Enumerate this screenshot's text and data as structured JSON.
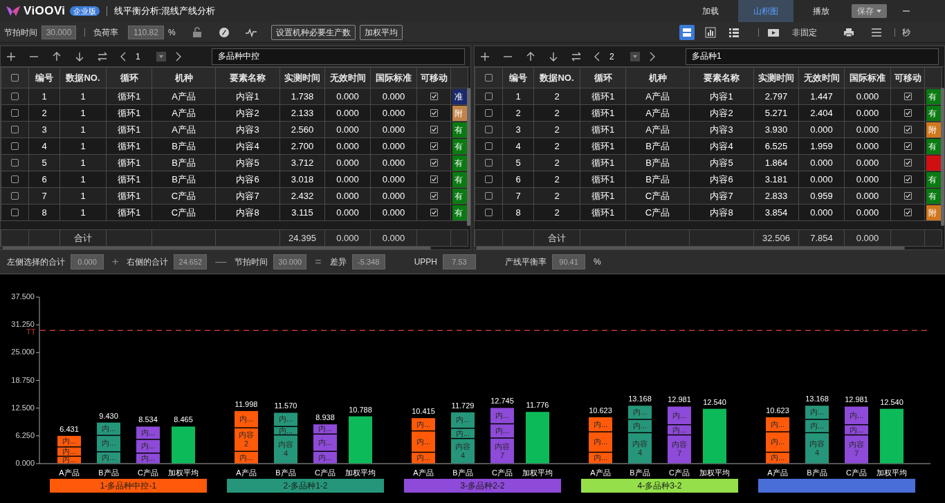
{
  "app": {
    "logo_text": "ViOOVi",
    "edition": "企业版",
    "title": "线平衡分析:混线产线分析"
  },
  "top_tabs": [
    {
      "label": "加载",
      "selected": false
    },
    {
      "label": "山积图",
      "selected": true
    },
    {
      "label": "播放",
      "selected": false
    }
  ],
  "save_button": "保存",
  "toolbar": {
    "takt_label": "节拍时间",
    "takt_value": "30.000",
    "load_label": "负荷率",
    "load_value": "110.82",
    "load_unit": "%",
    "buttons": [
      "设置机种必要生产数",
      "加权平均"
    ],
    "views": [
      {
        "selected": true
      },
      {
        "selected": false
      },
      {
        "selected": false
      }
    ],
    "mode": "非固定",
    "unit": "秒"
  },
  "panels": [
    {
      "page": "1",
      "name": "多品种中控",
      "header_checked": false,
      "columns": [
        "编号",
        "数据NO.",
        "循环",
        "机种",
        "要素名称",
        "实测时间",
        "无效时间",
        "国际标准",
        "可移动"
      ],
      "rows": [
        {
          "checked": false,
          "cells": [
            "1",
            "1",
            "循环1",
            "A产品",
            "内容1",
            "1.738",
            "0.000",
            "0.000"
          ],
          "movable": true,
          "tag": {
            "text": "准",
            "color": "#1b2a6b"
          }
        },
        {
          "checked": false,
          "cells": [
            "2",
            "1",
            "循环1",
            "A产品",
            "内容2",
            "2.133",
            "0.000",
            "0.000"
          ],
          "movable": true,
          "tag": {
            "text": "附",
            "color": "#c0844a"
          }
        },
        {
          "checked": false,
          "cells": [
            "3",
            "1",
            "循环1",
            "A产品",
            "内容3",
            "2.560",
            "0.000",
            "0.000"
          ],
          "movable": true,
          "tag": {
            "text": "有",
            "color": "#0b7a12"
          }
        },
        {
          "checked": false,
          "cells": [
            "4",
            "1",
            "循环1",
            "B产品",
            "内容4",
            "2.700",
            "0.000",
            "0.000"
          ],
          "movable": true,
          "tag": {
            "text": "有",
            "color": "#0b7a12"
          }
        },
        {
          "checked": false,
          "cells": [
            "5",
            "1",
            "循环1",
            "B产品",
            "内容5",
            "3.712",
            "0.000",
            "0.000"
          ],
          "movable": true,
          "tag": {
            "text": "有",
            "color": "#0b7a12"
          }
        },
        {
          "checked": false,
          "cells": [
            "6",
            "1",
            "循环1",
            "B产品",
            "内容6",
            "3.018",
            "0.000",
            "0.000"
          ],
          "movable": true,
          "tag": {
            "text": "有",
            "color": "#0b7a12"
          }
        },
        {
          "checked": false,
          "cells": [
            "7",
            "1",
            "循环1",
            "C产品",
            "内容7",
            "2.432",
            "0.000",
            "0.000"
          ],
          "movable": true,
          "tag": {
            "text": "有",
            "color": "#0b7a12"
          }
        },
        {
          "checked": false,
          "cells": [
            "8",
            "1",
            "循环1",
            "C产品",
            "内容8",
            "3.115",
            "0.000",
            "0.000"
          ],
          "movable": true,
          "tag": {
            "text": "有",
            "color": "#0b7a12"
          }
        }
      ],
      "footer": {
        "label": "合计",
        "values": [
          "24.395",
          "0.000",
          "0.000"
        ]
      }
    },
    {
      "page": "2",
      "name": "多品种1",
      "header_checked": false,
      "columns": [
        "编号",
        "数据NO.",
        "循环",
        "机种",
        "要素名称",
        "实测时间",
        "无效时间",
        "国际标准",
        "可移动"
      ],
      "rows": [
        {
          "checked": false,
          "cells": [
            "1",
            "2",
            "循环1",
            "A产品",
            "内容1",
            "2.797",
            "1.447",
            "0.000"
          ],
          "movable": true,
          "tag": {
            "text": "有",
            "color": "#0b7a12"
          }
        },
        {
          "checked": false,
          "cells": [
            "2",
            "2",
            "循环1",
            "A产品",
            "内容2",
            "5.271",
            "2.404",
            "0.000"
          ],
          "movable": true,
          "tag": {
            "text": "有",
            "color": "#0b7a12"
          }
        },
        {
          "checked": false,
          "cells": [
            "3",
            "2",
            "循环1",
            "A产品",
            "内容3",
            "3.930",
            "0.000",
            "0.000"
          ],
          "movable": true,
          "tag": {
            "text": "附",
            "color": "#d0781e"
          }
        },
        {
          "checked": false,
          "cells": [
            "4",
            "2",
            "循环1",
            "B产品",
            "内容4",
            "6.525",
            "1.959",
            "0.000"
          ],
          "movable": true,
          "tag": {
            "text": "有",
            "color": "#0b7a12"
          }
        },
        {
          "checked": false,
          "cells": [
            "5",
            "2",
            "循环1",
            "B产品",
            "内容5",
            "1.864",
            "0.000",
            "0.000"
          ],
          "movable": true,
          "tag": {
            "color": "#d01010"
          }
        },
        {
          "checked": false,
          "cells": [
            "6",
            "2",
            "循环1",
            "B产品",
            "内容6",
            "3.181",
            "0.000",
            "0.000"
          ],
          "movable": true,
          "tag": {
            "text": "有",
            "color": "#0b7a12"
          }
        },
        {
          "checked": false,
          "cells": [
            "7",
            "2",
            "循环1",
            "C产品",
            "内容7",
            "2.833",
            "0.959",
            "0.000"
          ],
          "movable": true,
          "tag": {
            "text": "有",
            "color": "#0b7a12"
          }
        },
        {
          "checked": false,
          "cells": [
            "8",
            "2",
            "循环1",
            "C产品",
            "内容8",
            "3.854",
            "0.000",
            "0.000"
          ],
          "movable": true,
          "tag": {
            "text": "附",
            "color": "#d0781e"
          }
        }
      ],
      "footer": {
        "label": "合计",
        "values": [
          "32.506",
          "7.854",
          "0.000"
        ]
      }
    }
  ],
  "summary": [
    {
      "label": "左侧选择的合计",
      "value": "0.000",
      "operator": "+"
    },
    {
      "label": "右侧的合计",
      "value": "24.652",
      "operator": "—"
    },
    {
      "label": "节拍时间",
      "value": "30.000",
      "operator": "="
    },
    {
      "label": "差异",
      "value": "-5.348"
    },
    {
      "label": "UPPH",
      "value": "7.53"
    },
    {
      "label": "产线平衡率",
      "value": "90.41",
      "unit": "%"
    }
  ],
  "chart": {
    "chart_data": {
      "type": "bar",
      "stacked": true,
      "ylim": [
        0,
        37.5
      ],
      "yticks": [
        {
          "value": 0,
          "label": "0.000"
        },
        {
          "value": 6.25,
          "label": "6.250"
        },
        {
          "value": 12.5,
          "label": "12.500"
        },
        {
          "value": 18.75,
          "label": "18.750"
        },
        {
          "value": 25,
          "label": "25.000"
        },
        {
          "value": 31.25,
          "label": "31.250"
        },
        {
          "value": 37.5,
          "label": "37.500"
        }
      ],
      "categories": [
        "A产品",
        "B产品",
        "C产品",
        "加权平均",
        "A产品",
        "B产品",
        "C产品",
        "加权平均",
        "A产品",
        "B产品",
        "C产品",
        "加权平均",
        "A产品",
        "B产品",
        "C产品",
        "加权平均",
        "A产品",
        "B产品",
        "C产品",
        "加权平均"
      ],
      "series": [
        {
          "colors": [
            "#ff5a0a",
            "#26967a",
            "#8e4ad8",
            "#0dba5a",
            "#ff5a0a",
            "#26967a",
            "#8e4ad8",
            "#0dba5a",
            "#ff5a0a",
            "#26967a",
            "#8e4ad8",
            "#0dba5a",
            "#ff5a0a",
            "#26967a",
            "#8e4ad8",
            "#0dba5a",
            "#ff5a0a",
            "#26967a",
            "#8e4ad8",
            "#0dba5a"
          ],
          "values": [
            1.7,
            2.7,
            2.4,
            8.5,
            2.8,
            6.5,
            2.8,
            10.8,
            2.6,
            5.7,
            5.8,
            11.8,
            2.6,
            7.0,
            6.5,
            12.5,
            2.6,
            7.0,
            6.5,
            12.5
          ]
        },
        {
          "colors": [
            "#ff5a0a",
            "#26967a",
            "#8e4ad8",
            null,
            "#ff5a0a",
            "#26967a",
            "#8e4ad8",
            null,
            "#ff5a0a",
            "#26967a",
            "#8e4ad8",
            null,
            "#ff5a0a",
            "#26967a",
            "#8e4ad8",
            null,
            "#ff5a0a",
            "#26967a",
            "#8e4ad8",
            null
          ],
          "values": [
            2.1,
            3.7,
            3.1,
            null,
            5.3,
            1.9,
            3.9,
            null,
            4.8,
            2.3,
            3.2,
            null,
            4.6,
            3.0,
            2.3,
            null,
            4.6,
            3.0,
            2.3,
            null
          ]
        },
        {
          "colors": [
            "#ff5a0a",
            "#26967a",
            "#8e4ad8",
            null,
            "#ff5a0a",
            "#26967a",
            "#8e4ad8",
            null,
            "#ff5a0a",
            "#26967a",
            "#8e4ad8",
            null,
            "#ff5a0a",
            "#26967a",
            "#8e4ad8",
            null,
            "#ff5a0a",
            "#26967a",
            "#8e4ad8",
            null
          ],
          "values": [
            2.6,
            3.0,
            3.0,
            null,
            3.9,
            3.2,
            2.3,
            null,
            3.0,
            3.7,
            3.7,
            null,
            3.4,
            3.2,
            4.2,
            null,
            3.4,
            3.2,
            4.2,
            null
          ]
        }
      ],
      "value_labels": [
        "6.431",
        "9.430",
        "8.534",
        "8.465",
        "11.998",
        "11.570",
        "8.938",
        "10.788",
        "10.415",
        "11.729",
        "12.745",
        "11.776",
        "10.623",
        "13.168",
        "12.981",
        "12.540",
        "10.623",
        "13.168",
        "12.981",
        "12.540"
      ],
      "ref_lines": [
        {
          "axis": "y",
          "value": 30,
          "label": "TT",
          "color": "#c0393b"
        }
      ]
    },
    "groups": [
      {
        "label": "1-多品种中控-1",
        "color": "#ff5a0a",
        "segment_labels": [
          [
            "内...",
            "内...",
            "内..."
          ],
          [
            "内...",
            "内...",
            "内..."
          ],
          [
            "内...",
            "内...",
            "内..."
          ]
        ]
      },
      {
        "label": "2-多品种1-2",
        "color": "#26967a",
        "segment_labels": [
          [
            "内...",
            "内容2",
            "内..."
          ],
          [
            "内...",
            "内...",
            "内容4"
          ],
          [
            "内...",
            "内...",
            "内..."
          ]
        ]
      },
      {
        "label": "3-多品种2-2",
        "color": "#8e4ad8",
        "segment_labels": [
          [
            "内...",
            "内...",
            "内..."
          ],
          [
            "内...",
            "内...",
            "内容4"
          ],
          [
            "内...",
            "内...",
            "内容7"
          ]
        ]
      },
      {
        "label": "4-多品种3-2",
        "color": "#95e04a",
        "segment_labels": [
          [
            "内...",
            "内...",
            "内..."
          ],
          [
            "内...",
            "内...",
            "内容4"
          ],
          [
            "内...",
            "内...",
            "内容7"
          ]
        ]
      },
      {
        "color": "#4a6ed8",
        "segment_labels": [
          [
            "内...",
            "内...",
            "内..."
          ],
          [
            "内...",
            "内...",
            "内容4"
          ],
          [
            "内...",
            "内...",
            "内容7"
          ]
        ]
      }
    ]
  }
}
